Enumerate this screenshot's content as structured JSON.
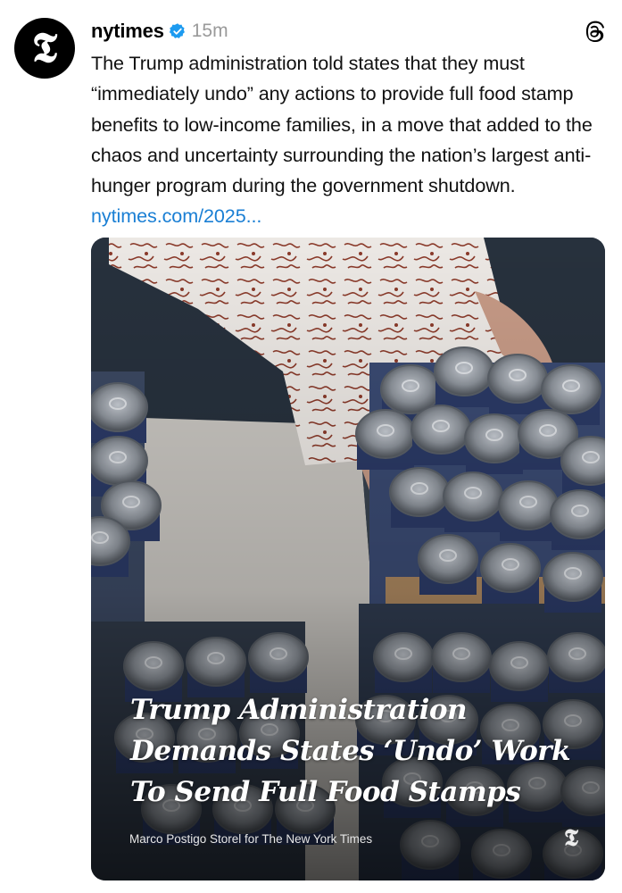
{
  "post": {
    "username": "nytimes",
    "timestamp": "15m",
    "avatar_glyph": "𝕿",
    "text": "The Trump administration told states that they must “immediately undo” any actions to provide full food stamp benefits to low-income families, in a move that added to the chaos and uncertainty surrounding the nation’s largest anti-hunger program during the government shutdown. ",
    "link_text": "nytimes.com/2025...",
    "verified": true
  },
  "media": {
    "headline_lines": [
      "Trump Administration",
      "Demands States ‘Undo’ Work",
      "To Send Full Food Stamps"
    ],
    "credit": "Marco Postigo Storel for The New York Times",
    "logo_glyph": "𝕿"
  },
  "icons": {
    "verified": "verified-badge-icon",
    "threads": "threads-logo-icon"
  },
  "colors": {
    "link": "#1a7fd4",
    "verified": "#1d9bf0",
    "timestamp": "#9a9a9a"
  }
}
